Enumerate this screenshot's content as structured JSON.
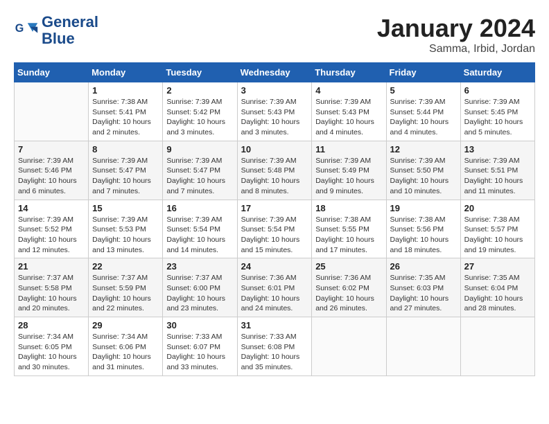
{
  "header": {
    "logo_line1": "General",
    "logo_line2": "Blue",
    "month": "January 2024",
    "location": "Samma, Irbid, Jordan"
  },
  "days_of_week": [
    "Sunday",
    "Monday",
    "Tuesday",
    "Wednesday",
    "Thursday",
    "Friday",
    "Saturday"
  ],
  "weeks": [
    [
      {
        "day": "",
        "info": ""
      },
      {
        "day": "1",
        "info": "Sunrise: 7:38 AM\nSunset: 5:41 PM\nDaylight: 10 hours\nand 2 minutes."
      },
      {
        "day": "2",
        "info": "Sunrise: 7:39 AM\nSunset: 5:42 PM\nDaylight: 10 hours\nand 3 minutes."
      },
      {
        "day": "3",
        "info": "Sunrise: 7:39 AM\nSunset: 5:43 PM\nDaylight: 10 hours\nand 3 minutes."
      },
      {
        "day": "4",
        "info": "Sunrise: 7:39 AM\nSunset: 5:43 PM\nDaylight: 10 hours\nand 4 minutes."
      },
      {
        "day": "5",
        "info": "Sunrise: 7:39 AM\nSunset: 5:44 PM\nDaylight: 10 hours\nand 4 minutes."
      },
      {
        "day": "6",
        "info": "Sunrise: 7:39 AM\nSunset: 5:45 PM\nDaylight: 10 hours\nand 5 minutes."
      }
    ],
    [
      {
        "day": "7",
        "info": "Sunrise: 7:39 AM\nSunset: 5:46 PM\nDaylight: 10 hours\nand 6 minutes."
      },
      {
        "day": "8",
        "info": "Sunrise: 7:39 AM\nSunset: 5:47 PM\nDaylight: 10 hours\nand 7 minutes."
      },
      {
        "day": "9",
        "info": "Sunrise: 7:39 AM\nSunset: 5:47 PM\nDaylight: 10 hours\nand 7 minutes."
      },
      {
        "day": "10",
        "info": "Sunrise: 7:39 AM\nSunset: 5:48 PM\nDaylight: 10 hours\nand 8 minutes."
      },
      {
        "day": "11",
        "info": "Sunrise: 7:39 AM\nSunset: 5:49 PM\nDaylight: 10 hours\nand 9 minutes."
      },
      {
        "day": "12",
        "info": "Sunrise: 7:39 AM\nSunset: 5:50 PM\nDaylight: 10 hours\nand 10 minutes."
      },
      {
        "day": "13",
        "info": "Sunrise: 7:39 AM\nSunset: 5:51 PM\nDaylight: 10 hours\nand 11 minutes."
      }
    ],
    [
      {
        "day": "14",
        "info": "Sunrise: 7:39 AM\nSunset: 5:52 PM\nDaylight: 10 hours\nand 12 minutes."
      },
      {
        "day": "15",
        "info": "Sunrise: 7:39 AM\nSunset: 5:53 PM\nDaylight: 10 hours\nand 13 minutes."
      },
      {
        "day": "16",
        "info": "Sunrise: 7:39 AM\nSunset: 5:54 PM\nDaylight: 10 hours\nand 14 minutes."
      },
      {
        "day": "17",
        "info": "Sunrise: 7:39 AM\nSunset: 5:54 PM\nDaylight: 10 hours\nand 15 minutes."
      },
      {
        "day": "18",
        "info": "Sunrise: 7:38 AM\nSunset: 5:55 PM\nDaylight: 10 hours\nand 17 minutes."
      },
      {
        "day": "19",
        "info": "Sunrise: 7:38 AM\nSunset: 5:56 PM\nDaylight: 10 hours\nand 18 minutes."
      },
      {
        "day": "20",
        "info": "Sunrise: 7:38 AM\nSunset: 5:57 PM\nDaylight: 10 hours\nand 19 minutes."
      }
    ],
    [
      {
        "day": "21",
        "info": "Sunrise: 7:37 AM\nSunset: 5:58 PM\nDaylight: 10 hours\nand 20 minutes."
      },
      {
        "day": "22",
        "info": "Sunrise: 7:37 AM\nSunset: 5:59 PM\nDaylight: 10 hours\nand 22 minutes."
      },
      {
        "day": "23",
        "info": "Sunrise: 7:37 AM\nSunset: 6:00 PM\nDaylight: 10 hours\nand 23 minutes."
      },
      {
        "day": "24",
        "info": "Sunrise: 7:36 AM\nSunset: 6:01 PM\nDaylight: 10 hours\nand 24 minutes."
      },
      {
        "day": "25",
        "info": "Sunrise: 7:36 AM\nSunset: 6:02 PM\nDaylight: 10 hours\nand 26 minutes."
      },
      {
        "day": "26",
        "info": "Sunrise: 7:35 AM\nSunset: 6:03 PM\nDaylight: 10 hours\nand 27 minutes."
      },
      {
        "day": "27",
        "info": "Sunrise: 7:35 AM\nSunset: 6:04 PM\nDaylight: 10 hours\nand 28 minutes."
      }
    ],
    [
      {
        "day": "28",
        "info": "Sunrise: 7:34 AM\nSunset: 6:05 PM\nDaylight: 10 hours\nand 30 minutes."
      },
      {
        "day": "29",
        "info": "Sunrise: 7:34 AM\nSunset: 6:06 PM\nDaylight: 10 hours\nand 31 minutes."
      },
      {
        "day": "30",
        "info": "Sunrise: 7:33 AM\nSunset: 6:07 PM\nDaylight: 10 hours\nand 33 minutes."
      },
      {
        "day": "31",
        "info": "Sunrise: 7:33 AM\nSunset: 6:08 PM\nDaylight: 10 hours\nand 35 minutes."
      },
      {
        "day": "",
        "info": ""
      },
      {
        "day": "",
        "info": ""
      },
      {
        "day": "",
        "info": ""
      }
    ]
  ]
}
